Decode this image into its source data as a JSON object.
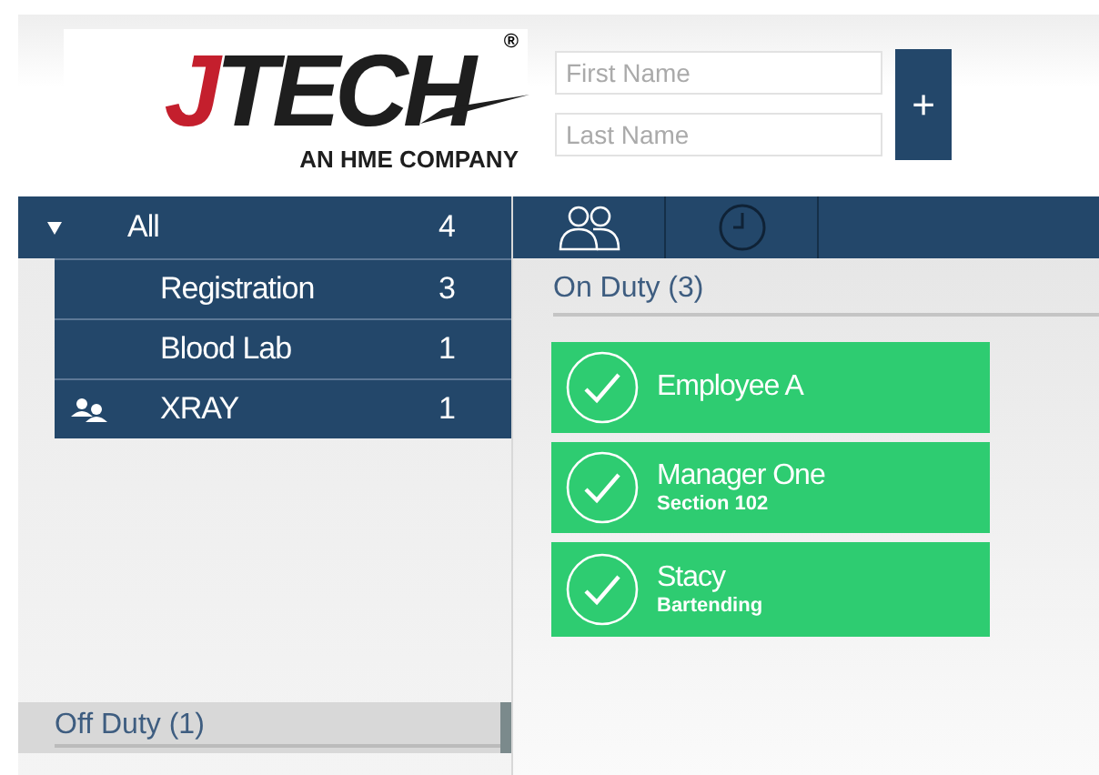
{
  "logo": {
    "initial": "J",
    "rest": "TECH",
    "mark": "®",
    "tagline": "AN HME COMPANY"
  },
  "form": {
    "first_name": {
      "placeholder": "First Name"
    },
    "last_name": {
      "placeholder": "Last Name"
    },
    "add_button": "+"
  },
  "groups": {
    "expanded": true,
    "label": "All",
    "count": "4",
    "children": [
      {
        "label": "Registration",
        "count": "3",
        "kind": "plain"
      },
      {
        "label": "Blood Lab",
        "count": "1",
        "kind": "plain"
      },
      {
        "label": "XRAY",
        "count": "1",
        "kind": "team"
      }
    ]
  },
  "view_tabs": [
    {
      "kind": "people"
    },
    {
      "kind": "clock"
    }
  ],
  "on_duty": {
    "title": "On Duty (3)",
    "employees": [
      {
        "name": "Employee A",
        "checked": true
      },
      {
        "name": "Manager One",
        "detail": "Section 102",
        "checked": true
      },
      {
        "name": "Stacy",
        "detail": "Bartending",
        "checked": true
      }
    ]
  },
  "off_duty": {
    "title": "Off Duty (1)"
  }
}
